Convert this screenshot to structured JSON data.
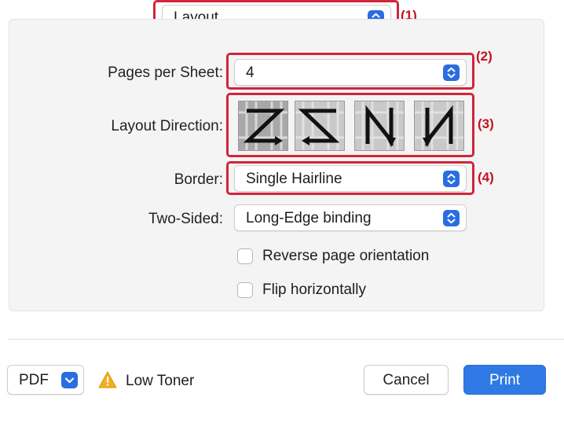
{
  "header_popup": {
    "value": "Layout",
    "callout": "(1)"
  },
  "fields": {
    "pages_per_sheet": {
      "label": "Pages per Sheet:",
      "value": "4",
      "callout": "(2)"
    },
    "layout_direction": {
      "label": "Layout Direction:",
      "callout": "(3)",
      "options": [
        "z-order",
        "reverse-z-order",
        "reverse-n-order",
        "n-order"
      ]
    },
    "border": {
      "label": "Border:",
      "value": "Single Hairline",
      "callout": "(4)"
    },
    "two_sided": {
      "label": "Two-Sided:",
      "value": "Long-Edge binding"
    }
  },
  "checkboxes": {
    "reverse_orientation": {
      "label": "Reverse page orientation",
      "checked": false
    },
    "flip_horizontally": {
      "label": "Flip horizontally",
      "checked": false
    }
  },
  "footer": {
    "pdf_label": "PDF",
    "warning_label": "Low Toner",
    "cancel_label": "Cancel",
    "print_label": "Print"
  },
  "colors": {
    "accent": "#2f79e4",
    "highlight": "#d0253a",
    "warning": "#f2b01e"
  }
}
